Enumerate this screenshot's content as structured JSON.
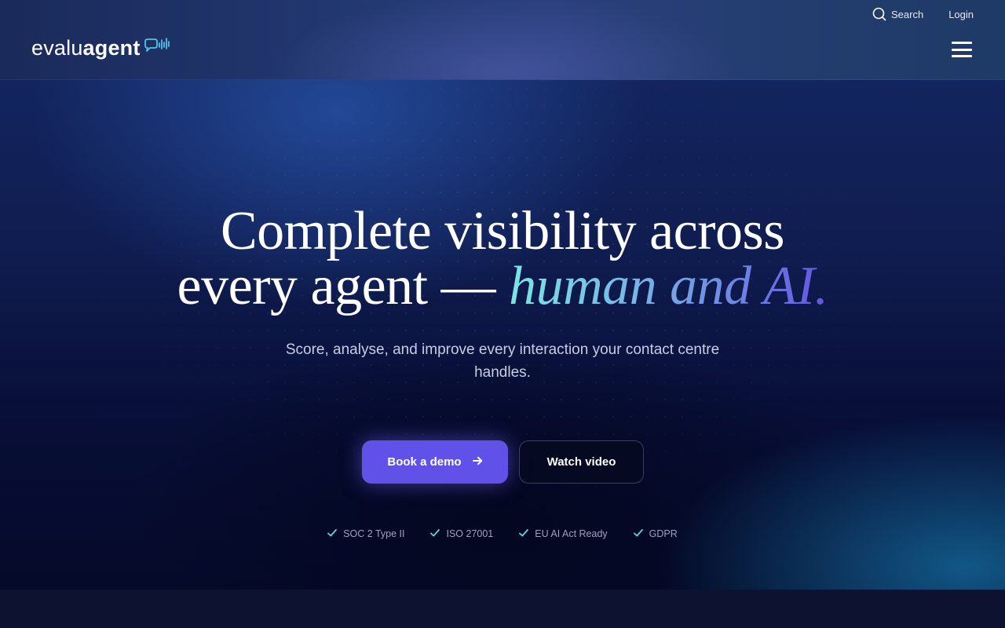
{
  "header": {
    "logo": {
      "light": "evalu",
      "bold": "agent",
      "icon": "soundwave-chat-icon"
    },
    "utility": {
      "search_label": "Search",
      "login_label": "Login"
    },
    "menu_icon": "hamburger-icon"
  },
  "hero": {
    "headline_line1": "Complete visibility across",
    "headline_line2_plain": "every agent — ",
    "headline_line2_accent": "human and AI.",
    "subheadline": "Score, analyse, and improve every interaction your contact centre handles.",
    "primary_cta": {
      "label": "Book a demo",
      "icon": "arrow-right-icon"
    },
    "secondary_cta": {
      "label": "Watch video"
    },
    "compliance_badges": [
      {
        "label": "SOC 2 Type II",
        "icon": "check-icon"
      },
      {
        "label": "ISO 27001",
        "icon": "check-icon"
      },
      {
        "label": "EU AI Act Ready",
        "icon": "check-icon"
      },
      {
        "label": "GDPR",
        "icon": "check-icon"
      }
    ]
  },
  "colors": {
    "primary_button": "#6052e8",
    "accent_gradient_start": "#7ee4e4",
    "accent_gradient_end": "#6254e0",
    "check_color": "#5fd6e0",
    "logo_icon": "#4fc3e8"
  }
}
